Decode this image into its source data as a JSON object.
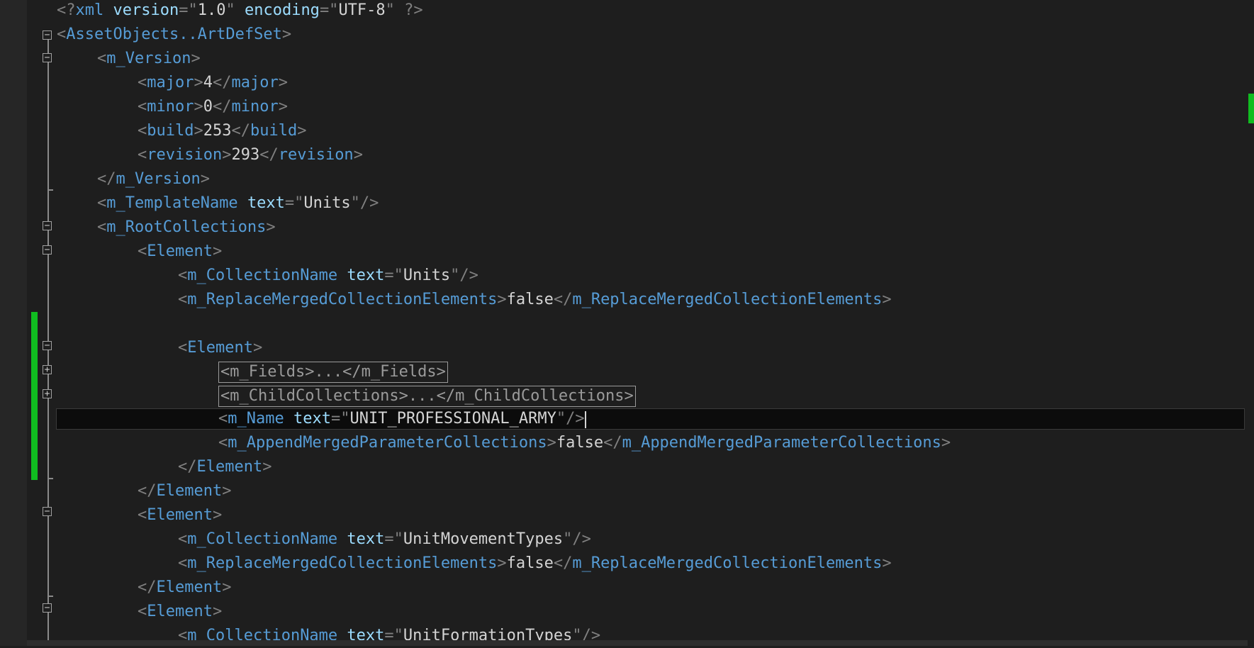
{
  "editor": {
    "lines": [
      {
        "tokens": [
          {
            "c": "p",
            "s": "<?"
          },
          {
            "c": "t",
            "s": "xml"
          },
          {
            "c": "x",
            "s": " "
          },
          {
            "c": "a",
            "s": "version"
          },
          {
            "c": "p",
            "s": "=\""
          },
          {
            "c": "v",
            "s": "1.0"
          },
          {
            "c": "p",
            "s": "\""
          },
          {
            "c": "x",
            "s": " "
          },
          {
            "c": "a",
            "s": "encoding"
          },
          {
            "c": "p",
            "s": "=\""
          },
          {
            "c": "v",
            "s": "UTF-8"
          },
          {
            "c": "p",
            "s": "\""
          },
          {
            "c": "x",
            "s": " "
          },
          {
            "c": "p",
            "s": "?>"
          }
        ]
      },
      {
        "tokens": [
          {
            "c": "p",
            "s": "<"
          },
          {
            "c": "t",
            "s": "AssetObjects..ArtDefSet"
          },
          {
            "c": "p",
            "s": ">"
          }
        ]
      },
      {
        "tokens": [
          {
            "c": "p",
            "s": "<"
          },
          {
            "c": "t",
            "s": "m_Version"
          },
          {
            "c": "p",
            "s": ">"
          }
        ]
      },
      {
        "tokens": [
          {
            "c": "p",
            "s": "<"
          },
          {
            "c": "t",
            "s": "major"
          },
          {
            "c": "p",
            "s": ">"
          },
          {
            "c": "x",
            "s": "4"
          },
          {
            "c": "p",
            "s": "</"
          },
          {
            "c": "t",
            "s": "major"
          },
          {
            "c": "p",
            "s": ">"
          }
        ]
      },
      {
        "tokens": [
          {
            "c": "p",
            "s": "<"
          },
          {
            "c": "t",
            "s": "minor"
          },
          {
            "c": "p",
            "s": ">"
          },
          {
            "c": "x",
            "s": "0"
          },
          {
            "c": "p",
            "s": "</"
          },
          {
            "c": "t",
            "s": "minor"
          },
          {
            "c": "p",
            "s": ">"
          }
        ]
      },
      {
        "tokens": [
          {
            "c": "p",
            "s": "<"
          },
          {
            "c": "t",
            "s": "build"
          },
          {
            "c": "p",
            "s": ">"
          },
          {
            "c": "x",
            "s": "253"
          },
          {
            "c": "p",
            "s": "</"
          },
          {
            "c": "t",
            "s": "build"
          },
          {
            "c": "p",
            "s": ">"
          }
        ]
      },
      {
        "tokens": [
          {
            "c": "p",
            "s": "<"
          },
          {
            "c": "t",
            "s": "revision"
          },
          {
            "c": "p",
            "s": ">"
          },
          {
            "c": "x",
            "s": "293"
          },
          {
            "c": "p",
            "s": "</"
          },
          {
            "c": "t",
            "s": "revision"
          },
          {
            "c": "p",
            "s": ">"
          }
        ]
      },
      {
        "tokens": [
          {
            "c": "p",
            "s": "</"
          },
          {
            "c": "t",
            "s": "m_Version"
          },
          {
            "c": "p",
            "s": ">"
          }
        ]
      },
      {
        "tokens": [
          {
            "c": "p",
            "s": "<"
          },
          {
            "c": "t",
            "s": "m_TemplateName"
          },
          {
            "c": "x",
            "s": " "
          },
          {
            "c": "a",
            "s": "text"
          },
          {
            "c": "p",
            "s": "=\""
          },
          {
            "c": "v",
            "s": "Units"
          },
          {
            "c": "p",
            "s": "\"/>"
          }
        ]
      },
      {
        "tokens": [
          {
            "c": "p",
            "s": "<"
          },
          {
            "c": "t",
            "s": "m_RootCollections"
          },
          {
            "c": "p",
            "s": ">"
          }
        ]
      },
      {
        "tokens": [
          {
            "c": "p",
            "s": "<"
          },
          {
            "c": "t",
            "s": "Element"
          },
          {
            "c": "p",
            "s": ">"
          }
        ]
      },
      {
        "tokens": [
          {
            "c": "p",
            "s": "<"
          },
          {
            "c": "t",
            "s": "m_CollectionName"
          },
          {
            "c": "x",
            "s": " "
          },
          {
            "c": "a",
            "s": "text"
          },
          {
            "c": "p",
            "s": "=\""
          },
          {
            "c": "v",
            "s": "Units"
          },
          {
            "c": "p",
            "s": "\"/>"
          }
        ]
      },
      {
        "tokens": [
          {
            "c": "p",
            "s": "<"
          },
          {
            "c": "t",
            "s": "m_ReplaceMergedCollectionElements"
          },
          {
            "c": "p",
            "s": ">"
          },
          {
            "c": "x",
            "s": "false"
          },
          {
            "c": "p",
            "s": "</"
          },
          {
            "c": "t",
            "s": "m_ReplaceMergedCollectionElements"
          },
          {
            "c": "p",
            "s": ">"
          }
        ]
      },
      {
        "tokens": []
      },
      {
        "tokens": [
          {
            "c": "p",
            "s": "<"
          },
          {
            "c": "t",
            "s": "Element"
          },
          {
            "c": "p",
            "s": ">"
          }
        ]
      },
      {
        "collapsed": true,
        "tokens": [
          {
            "c": "q",
            "s": "<m_Fields>...</m_Fields>"
          }
        ]
      },
      {
        "collapsed": true,
        "tokens": [
          {
            "c": "q",
            "s": "<m_ChildCollections>...</m_ChildCollections>"
          }
        ]
      },
      {
        "current": true,
        "tokens": [
          {
            "c": "p",
            "s": "<"
          },
          {
            "c": "t",
            "s": "m_Name"
          },
          {
            "c": "x",
            "s": " "
          },
          {
            "c": "a",
            "s": "text"
          },
          {
            "c": "p",
            "s": "=\""
          },
          {
            "c": "v",
            "s": "UNIT_PROFESSIONAL_ARMY"
          },
          {
            "c": "p",
            "s": "\"/>"
          }
        ]
      },
      {
        "tokens": [
          {
            "c": "p",
            "s": "<"
          },
          {
            "c": "t",
            "s": "m_AppendMergedParameterCollections"
          },
          {
            "c": "p",
            "s": ">"
          },
          {
            "c": "x",
            "s": "false"
          },
          {
            "c": "p",
            "s": "</"
          },
          {
            "c": "t",
            "s": "m_AppendMergedParameterCollections"
          },
          {
            "c": "p",
            "s": ">"
          }
        ]
      },
      {
        "tokens": [
          {
            "c": "p",
            "s": "</"
          },
          {
            "c": "t",
            "s": "Element"
          },
          {
            "c": "p",
            "s": ">"
          }
        ]
      },
      {
        "tokens": [
          {
            "c": "p",
            "s": "</"
          },
          {
            "c": "t",
            "s": "Element"
          },
          {
            "c": "p",
            "s": ">"
          }
        ]
      },
      {
        "tokens": [
          {
            "c": "p",
            "s": "<"
          },
          {
            "c": "t",
            "s": "Element"
          },
          {
            "c": "p",
            "s": ">"
          }
        ]
      },
      {
        "tokens": [
          {
            "c": "p",
            "s": "<"
          },
          {
            "c": "t",
            "s": "m_CollectionName"
          },
          {
            "c": "x",
            "s": " "
          },
          {
            "c": "a",
            "s": "text"
          },
          {
            "c": "p",
            "s": "=\""
          },
          {
            "c": "v",
            "s": "UnitMovementTypes"
          },
          {
            "c": "p",
            "s": "\"/>"
          }
        ]
      },
      {
        "tokens": [
          {
            "c": "p",
            "s": "<"
          },
          {
            "c": "t",
            "s": "m_ReplaceMergedCollectionElements"
          },
          {
            "c": "p",
            "s": ">"
          },
          {
            "c": "x",
            "s": "false"
          },
          {
            "c": "p",
            "s": "</"
          },
          {
            "c": "t",
            "s": "m_ReplaceMergedCollectionElements"
          },
          {
            "c": "p",
            "s": ">"
          }
        ]
      },
      {
        "tokens": [
          {
            "c": "p",
            "s": "</"
          },
          {
            "c": "t",
            "s": "Element"
          },
          {
            "c": "p",
            "s": ">"
          }
        ]
      },
      {
        "tokens": [
          {
            "c": "p",
            "s": "<"
          },
          {
            "c": "t",
            "s": "Element"
          },
          {
            "c": "p",
            "s": ">"
          }
        ]
      },
      {
        "tokens": [
          {
            "c": "p",
            "s": "<"
          },
          {
            "c": "t",
            "s": "m_CollectionName"
          },
          {
            "c": "x",
            "s": " "
          },
          {
            "c": "a",
            "s": "text"
          },
          {
            "c": "p",
            "s": "=\""
          },
          {
            "c": "v",
            "s": "UnitFormationTypes"
          },
          {
            "c": "p",
            "s": "\"/>"
          }
        ]
      }
    ]
  },
  "fold_glyphs": {
    "expanded": "−",
    "collapsed": "+"
  },
  "theme": {
    "background": "#1e1e1e",
    "tag": "#569cd6",
    "attribute": "#9cdcfe",
    "punctuation": "#808080",
    "text": "#d4d4d4",
    "change_marker": "#10bd20"
  }
}
